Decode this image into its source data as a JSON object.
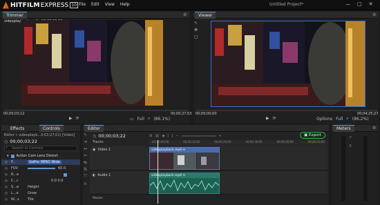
{
  "app": {
    "logo_hit": "HITFILM",
    "logo_express": "EXPRESS",
    "logo_version": "10",
    "menu": [
      "File",
      "Edit",
      "View",
      "Help"
    ],
    "document_title": "Untitled Project*",
    "window_controls": [
      "—",
      "□",
      "✕"
    ]
  },
  "trimmer": {
    "tab": "Trimmer",
    "file_info": "videoplayback.mp4 - 00;00;00;00",
    "timecode_start": "00;00;03;12",
    "timecode_end": "00;00;27;03",
    "zoom_fit": "Full",
    "zoom_pct": "(86.1%)"
  },
  "viewer": {
    "tab": "Viewer",
    "timecode_start": "00;00;00;00",
    "timecode_end": "00;04;25;27",
    "options": "Options",
    "zoom_fit": "Full",
    "zoom_pct": "(86.2%)"
  },
  "left_panel": {
    "tabs": [
      "Effects",
      "Controls"
    ],
    "editor_path": "Editor » videoplayb...0;03;27;01) [Video]",
    "timecode": "00;00;03;22",
    "search_placeholder": "Search in Controls",
    "effect_name": "Action Cam Lens Distort",
    "rows": [
      {
        "label": "P...",
        "value": "GoPro HERO Wide"
      },
      {
        "label": "FOV",
        "value": "60.0"
      },
      {
        "label": "R...e",
        "value": ""
      },
      {
        "label": "C...r",
        "value": "0.0   0.0"
      },
      {
        "label": "S...e",
        "value": "Height"
      },
      {
        "label": "L...e",
        "value": "Grow"
      },
      {
        "label": "W...s",
        "value": "Tile"
      }
    ]
  },
  "editor": {
    "tab": "Editor",
    "timecode": "00;00;03;22",
    "export_label": "Export",
    "tracks_label": "Tracks",
    "ruler": [
      "00;00;00;00",
      "00;00;10;00",
      "00;00;20;00",
      "00;00;30;00",
      "00;00;40;00",
      "00;00;50;00"
    ],
    "video_track": "Video 1",
    "audio_track": "Audio 1",
    "video_clip_label": "videoplayback.mp4 ⇔",
    "audio_clip_label": "videoplayback.mp4 ⇔",
    "master_label": "Master"
  },
  "meters": {
    "tab": "Meters",
    "scale": [
      "-7",
      "-5"
    ]
  },
  "colors": {
    "accent_blue": "#5b9bd5",
    "export_green": "#2dbe4a",
    "logo_orange": "#f08a24"
  }
}
